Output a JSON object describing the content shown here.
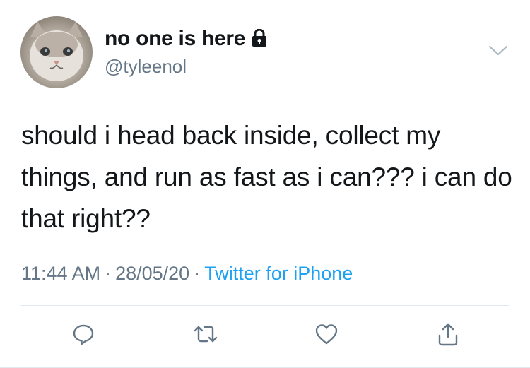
{
  "user": {
    "display_name": "no one is here",
    "handle": "@tyleenol",
    "protected_icon": "lock-icon",
    "avatar": "avatar"
  },
  "tweet": {
    "text": "should i head back inside, collect my things, and run as fast as i can??? i can do that right??",
    "time": "11:44 AM",
    "date": "28/05/20",
    "separator": "·",
    "source": "Twitter for iPhone"
  },
  "actions": [
    {
      "name": "reply",
      "icon": "reply-icon"
    },
    {
      "name": "retweet",
      "icon": "retweet-icon"
    },
    {
      "name": "like",
      "icon": "heart-icon"
    },
    {
      "name": "share",
      "icon": "share-icon"
    }
  ],
  "colors": {
    "text": "#14171a",
    "secondary": "#657786",
    "accent": "#1da1f2",
    "divider": "#e1e8ed"
  }
}
